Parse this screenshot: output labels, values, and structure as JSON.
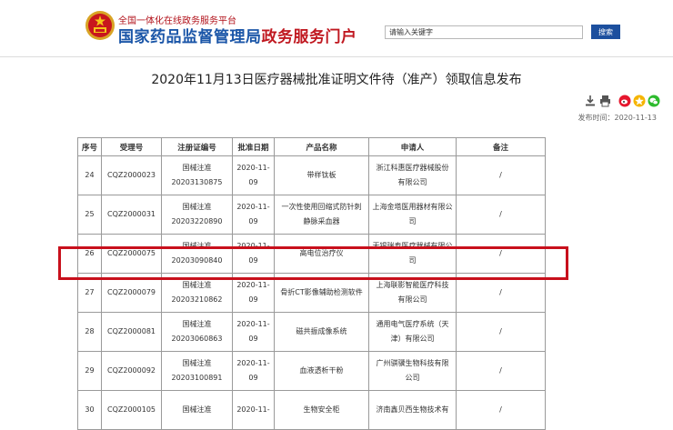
{
  "header": {
    "subtitle": "全国一体化在线政务服务平台",
    "title_part1": "国家药品监督管理局",
    "title_part2": "政务服务门户",
    "search_placeholder": "请输入关键字",
    "search_button": "搜索"
  },
  "article": {
    "title": "2020年11月13日医疗器械批准证明文件待（准产）领取信息发布",
    "publish_date": "发布时间：2020-11-13"
  },
  "table": {
    "headers": [
      "序号",
      "受理号",
      "注册证编号",
      "批准日期",
      "产品名称",
      "申请人",
      "备注"
    ],
    "rows": [
      {
        "no": "24",
        "accept": "CQZ2000023",
        "reg": [
          "国械注准",
          "20203130875"
        ],
        "date": [
          "2020-11-",
          "09"
        ],
        "product": [
          "带样钛板"
        ],
        "applicant": [
          "浙江科惠医疗器械股份",
          "有限公司"
        ],
        "note": "/"
      },
      {
        "no": "25",
        "accept": "CQZ2000031",
        "reg": [
          "国械注准",
          "20203220890"
        ],
        "date": [
          "2020-11-",
          "09"
        ],
        "product": [
          "一次性使用回缩式防针刺",
          "静脉采血器"
        ],
        "applicant": [
          "上海金塔医用器材有限公",
          "司"
        ],
        "note": "/"
      },
      {
        "no": "26",
        "accept": "CQZ2000075",
        "reg": [
          "国械注准",
          "20203090840"
        ],
        "date": [
          "2020-11-",
          "09"
        ],
        "product": [
          "高电位治疗仪"
        ],
        "applicant": [
          "无锡瑞寿医疗器械有限公",
          "司"
        ],
        "note": "/"
      },
      {
        "no": "27",
        "accept": "CQZ2000079",
        "reg": [
          "国械注准",
          "20203210862"
        ],
        "date": [
          "2020-11-",
          "09"
        ],
        "product": [
          "骨折CT影像辅助检测软件"
        ],
        "applicant": [
          "上海联影智能医疗科技",
          "有限公司"
        ],
        "note": "/"
      },
      {
        "no": "28",
        "accept": "CQZ2000081",
        "reg": [
          "国械注准",
          "20203060863"
        ],
        "date": [
          "2020-11-",
          "09"
        ],
        "product": [
          "磁共振成像系统"
        ],
        "applicant": [
          "通用电气医疗系统（天",
          "津）有限公司"
        ],
        "note": "/"
      },
      {
        "no": "29",
        "accept": "CQZ2000092",
        "reg": [
          "国械注准",
          "20203100891"
        ],
        "date": [
          "2020-11-",
          "09"
        ],
        "product": [
          "血液透析干粉"
        ],
        "applicant": [
          "广州骐骥生物科技有限",
          "公司"
        ],
        "note": "/"
      },
      {
        "no": "30",
        "accept": "CQZ2000105",
        "reg": [
          "国械注准",
          ""
        ],
        "date": [
          "2020-11-",
          ""
        ],
        "product": [
          "生物安全柜"
        ],
        "applicant": [
          "济南鑫贝西生物技术有",
          ""
        ],
        "note": "/"
      }
    ]
  }
}
